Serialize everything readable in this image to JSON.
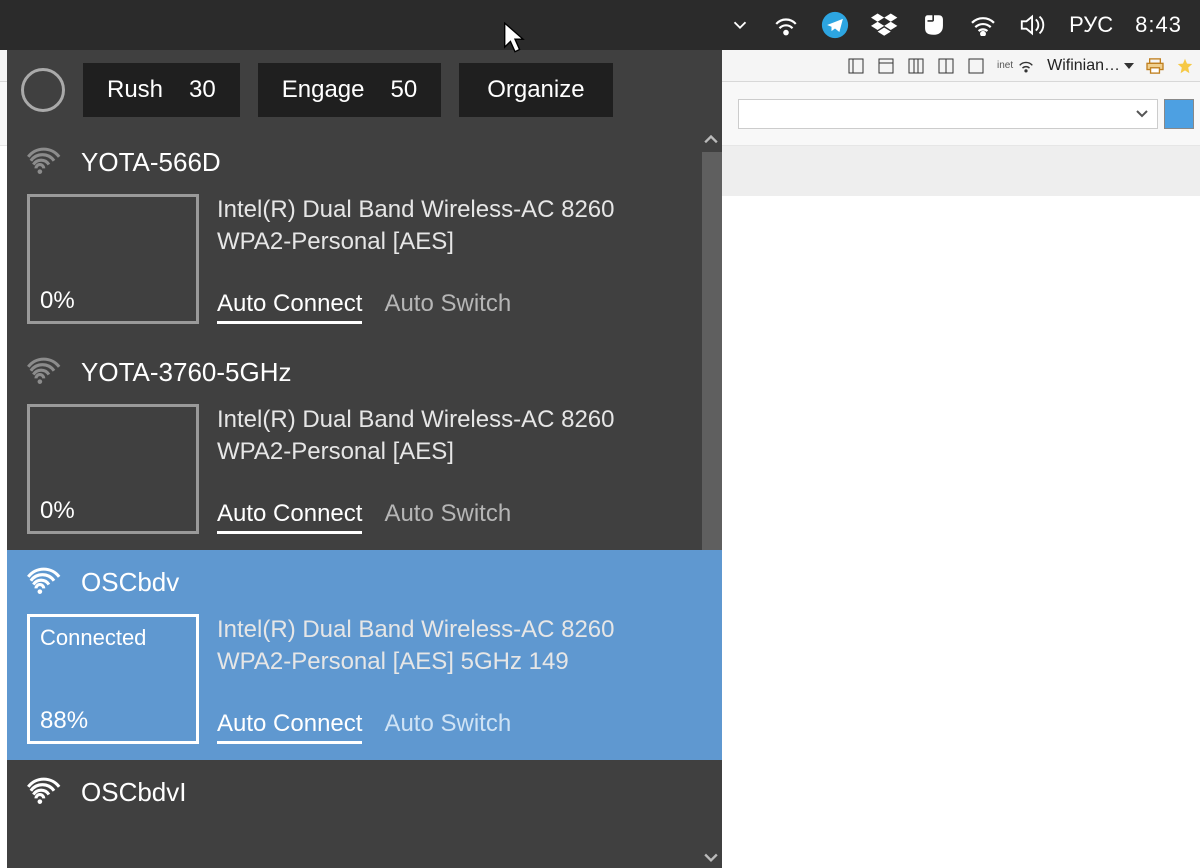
{
  "taskbar": {
    "language": "РУС",
    "clock": "8:43"
  },
  "toolbar2": {
    "inet_label": "inet",
    "menu_label": "Wifinian…"
  },
  "panel": {
    "scan_label": "",
    "buttons": {
      "rush_label": "Rush",
      "rush_value": "30",
      "engage_label": "Engage",
      "engage_value": "50",
      "organize_label": "Organize"
    }
  },
  "labels": {
    "auto_connect": "Auto Connect",
    "auto_switch": "Auto Switch"
  },
  "networks": [
    {
      "ssid": "YOTA-566D",
      "adapter_line1": "Intel(R) Dual Band Wireless-AC 8260",
      "adapter_line2": "WPA2-Personal [AES]",
      "status": "",
      "percent": "0%",
      "selected": false,
      "signal_level": 0
    },
    {
      "ssid": "YOTA-3760-5GHz",
      "adapter_line1": "Intel(R) Dual Band Wireless-AC 8260",
      "adapter_line2": "WPA2-Personal [AES]",
      "status": "",
      "percent": "0%",
      "selected": false,
      "signal_level": 0
    },
    {
      "ssid": "OSCbdv",
      "adapter_line1": "Intel(R) Dual Band Wireless-AC 8260",
      "adapter_line2": "WPA2-Personal [AES] 5GHz 149",
      "status": "Connected",
      "percent": "88%",
      "selected": true,
      "signal_level": 4
    },
    {
      "ssid": "OSCbdvI",
      "adapter_line1": "",
      "adapter_line2": "",
      "status": "",
      "percent": "",
      "selected": false,
      "signal_level": 4
    }
  ]
}
